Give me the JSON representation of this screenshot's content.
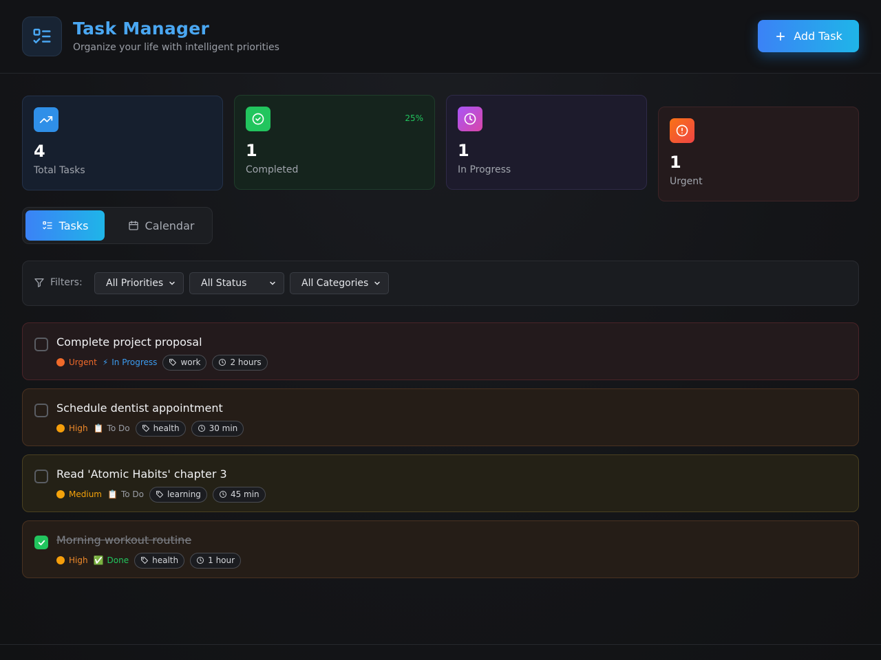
{
  "header": {
    "title": "Task Manager",
    "subtitle": "Organize your life with intelligent priorities",
    "add_label": "Add Task",
    "logo_icon": "list-check-icon"
  },
  "stats": [
    {
      "value": "4",
      "label": "Total Tasks",
      "icon": "trending-up-icon",
      "color": "#2f8fe8"
    },
    {
      "value": "1",
      "label": "Completed",
      "percent": "25%",
      "icon": "check-circle-icon",
      "color": "#22c55e"
    },
    {
      "value": "1",
      "label": "In Progress",
      "icon": "clock-icon",
      "color": "#c04fc9"
    },
    {
      "value": "1",
      "label": "Urgent",
      "icon": "alert-circle-icon",
      "color": "#f0562a"
    }
  ],
  "tabs": [
    {
      "label": "Tasks",
      "icon": "list-icon",
      "active": true
    },
    {
      "label": "Calendar",
      "icon": "calendar-icon",
      "active": false
    }
  ],
  "filters": {
    "label": "Filters:",
    "priority": "All Priorities",
    "status": "All Status",
    "category": "All Categories"
  },
  "tasks": [
    {
      "title": "Complete project proposal",
      "priority": "Urgent",
      "priority_color": "#f06a2a",
      "status_icon": "⚡",
      "status": "In Progress",
      "status_color": "#3b9cf0",
      "category": "work",
      "duration": "2 hours",
      "done": false
    },
    {
      "title": "Schedule dentist appointment",
      "priority": "High",
      "priority_color": "#f59e0b",
      "status_icon": "📋",
      "status": "To Do",
      "status_color": "#9a9ea6",
      "category": "health",
      "duration": "30 min",
      "done": false
    },
    {
      "title": "Read 'Atomic Habits' chapter 3",
      "priority": "Medium",
      "priority_color": "#f5a30b",
      "status_icon": "📋",
      "status": "To Do",
      "status_color": "#9a9ea6",
      "category": "learning",
      "duration": "45 min",
      "done": false
    },
    {
      "title": "Morning workout routine",
      "priority": "High",
      "priority_color": "#f59e0b",
      "status_icon": "✅",
      "status": "Done",
      "status_color": "#22c55e",
      "category": "health",
      "duration": "1 hour",
      "done": true
    }
  ]
}
